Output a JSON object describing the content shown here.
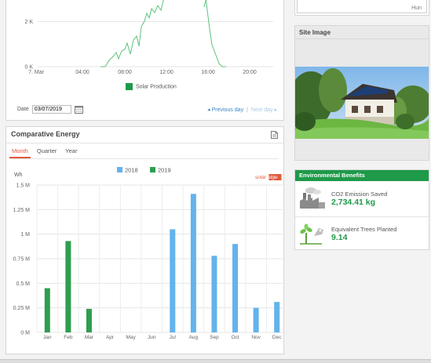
{
  "production": {
    "y_ticks": [
      "2 K",
      "0 K"
    ],
    "x_ticks": [
      "7. Mar",
      "04:00",
      "08:00",
      "12:00",
      "16:00",
      "20:00"
    ],
    "legend": "Solar Production",
    "date_label": "Date",
    "date_value": "03/07/2019",
    "prev_day": "◂ Previous day",
    "separator": "|",
    "next_day": "Next day ▸",
    "colors": {
      "line": "#5cc37b"
    }
  },
  "comparative": {
    "title": "Comparative Energy",
    "tabs": [
      "Month",
      "Quarter",
      "Year"
    ],
    "active_tab": "Month",
    "brand_solar": "solar",
    "brand_edge": "edge"
  },
  "site": {
    "title": "Site Image",
    "top_select_text": "Hun"
  },
  "environment": {
    "title": "Environmental Benefits",
    "co2_label": "CO2 Emission Saved",
    "co2_value": "2,734.41 kg",
    "trees_label": "Equivalent Trees Planted",
    "trees_value": "9.14"
  },
  "chart_data": [
    {
      "type": "line",
      "series": [
        {
          "name": "Solar Production"
        }
      ],
      "x": [
        "7. Mar",
        "04:00",
        "08:00",
        "12:00",
        "16:00",
        "20:00"
      ],
      "ylim": [
        0,
        3
      ],
      "y_unit": "K",
      "grid": true,
      "legend": "bottom"
    },
    {
      "type": "bar",
      "ylabel": "Wh",
      "categories": [
        "Jan",
        "Feb",
        "Mar",
        "Apr",
        "May",
        "Jun",
        "Jul",
        "Aug",
        "Sep",
        "Oct",
        "Nov",
        "Dec"
      ],
      "series": [
        {
          "name": "2018",
          "color": "#63b3ec",
          "values": [
            null,
            null,
            null,
            null,
            null,
            null,
            1.05,
            1.41,
            0.78,
            0.9,
            0.25,
            0.31
          ]
        },
        {
          "name": "2019",
          "color": "#2e9e4f",
          "values": [
            0.45,
            0.93,
            0.24,
            null,
            null,
            null,
            null,
            null,
            null,
            null,
            null,
            null
          ]
        }
      ],
      "y_ticks": [
        "1.5 M",
        "1.25 M",
        "1 M",
        "0.75 M",
        "0.5 M",
        "0.25 M",
        "0 M"
      ],
      "ylim": [
        0,
        1.5
      ],
      "value_unit": "M",
      "grid": true,
      "legend": "top"
    }
  ]
}
